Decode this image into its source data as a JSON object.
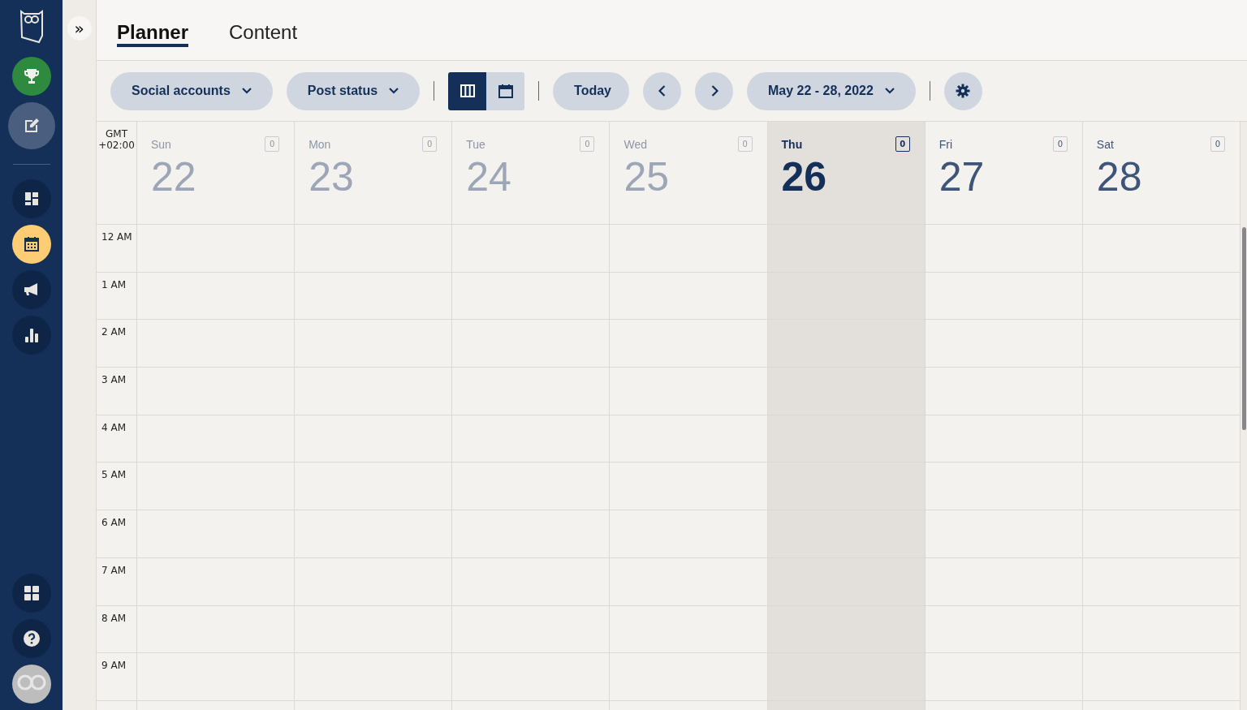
{
  "sidebar": {
    "top_items": [
      {
        "kind": "trophy",
        "selected": false
      },
      {
        "kind": "compose",
        "selected": false
      }
    ],
    "items": [
      {
        "kind": "dashboard",
        "selected": false
      },
      {
        "kind": "calendar",
        "selected": true
      },
      {
        "kind": "megaphone",
        "selected": false
      },
      {
        "kind": "analytics",
        "selected": false
      }
    ],
    "bottom_items": [
      {
        "kind": "apps"
      },
      {
        "kind": "help"
      },
      {
        "kind": "avatar"
      }
    ]
  },
  "collapse_button": "»",
  "tabs": [
    {
      "label": "Planner",
      "selected": true
    },
    {
      "label": "Content",
      "selected": false
    }
  ],
  "toolbar": {
    "social_accounts": "Social accounts",
    "post_status": "Post status",
    "views": [
      {
        "kind": "week",
        "selected": true
      },
      {
        "kind": "month",
        "selected": false
      }
    ],
    "today": "Today",
    "date_range": "May 22 - 28, 2022"
  },
  "calendar": {
    "timezone": [
      "GMT",
      "+02:00"
    ],
    "days": [
      {
        "name": "Sun",
        "date": "22",
        "count": "0",
        "kind": "past"
      },
      {
        "name": "Mon",
        "date": "23",
        "count": "0",
        "kind": "past"
      },
      {
        "name": "Tue",
        "date": "24",
        "count": "0",
        "kind": "past"
      },
      {
        "name": "Wed",
        "date": "25",
        "count": "0",
        "kind": "past"
      },
      {
        "name": "Thu",
        "date": "26",
        "count": "0",
        "kind": "today"
      },
      {
        "name": "Fri",
        "date": "27",
        "count": "0",
        "kind": "future"
      },
      {
        "name": "Sat",
        "date": "28",
        "count": "0",
        "kind": "future"
      }
    ],
    "hours": [
      "12 AM",
      "1 AM",
      "2 AM",
      "3 AM",
      "4 AM",
      "5 AM",
      "6 AM",
      "7 AM",
      "8 AM",
      "9 AM"
    ]
  }
}
